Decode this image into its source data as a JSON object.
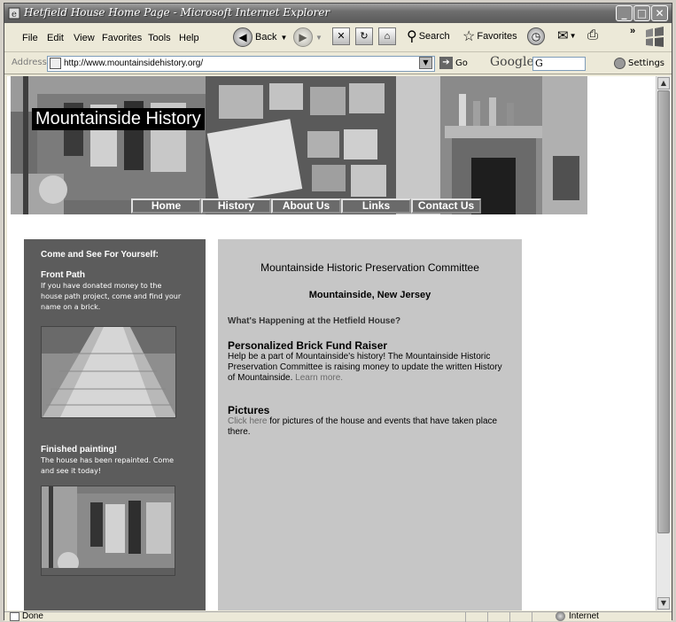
{
  "window": {
    "title": "Hetfield House Home Page - Microsoft Internet Explorer",
    "minimize_glyph": "_",
    "maximize_glyph": "□",
    "close_glyph": "✕"
  },
  "menubar": {
    "items": [
      "File",
      "Edit",
      "View",
      "Favorites",
      "Tools",
      "Help"
    ]
  },
  "toolbar": {
    "back_label": "Back",
    "search_label": "Search",
    "favorites_label": "Favorites",
    "overflow_glyph": "»"
  },
  "addressbar": {
    "label": "Address",
    "url": "http://www.mountainsidehistory.org/",
    "go_label": "Go",
    "google_label": "Google",
    "google_g": "G",
    "settings_label": "Settings"
  },
  "page": {
    "site_title": "Mountainside History",
    "nav": [
      "Home",
      "History",
      "About Us",
      "Links",
      "Contact Us"
    ],
    "sidebar": {
      "heading": "Come and See For Yourself:",
      "items": [
        {
          "title": "Front Path",
          "text": "If you have donated money to the house path project, come and find your name on a brick."
        },
        {
          "title": "Finished painting!",
          "text": "The house has been repainted. Come and see it today!"
        }
      ]
    },
    "main": {
      "committee": "Mountainside Historic Preservation Committee",
      "location": "Mountainside, New Jersey",
      "happening": "What's Happening at the Hetfield House?",
      "fundraiser_title": "Personalized Brick Fund Raiser",
      "fundraiser_text": "Help be a part of Mountainside's history!  The Mountainside Historic Preservation Committee is raising money to update the written History of Mountainside.",
      "learn_more": "Learn more.",
      "pictures_title": "Pictures",
      "click_here": "Click here",
      "pictures_text": "for pictures of the house and events that have taken place there."
    }
  },
  "statusbar": {
    "status": "Done",
    "zone": "Internet"
  }
}
